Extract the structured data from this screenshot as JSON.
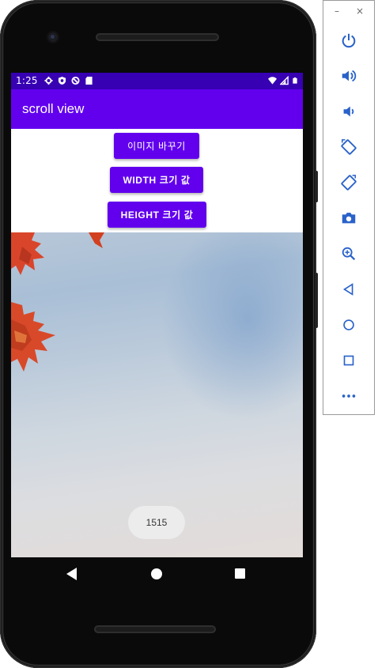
{
  "status_bar": {
    "time": "1:25",
    "icons_left": [
      "settings-icon",
      "shield-icon",
      "no-disturb-icon",
      "sd-card-icon"
    ],
    "icons_right": [
      "wifi-icon",
      "signal-icon",
      "battery-icon"
    ],
    "color": "#3700b3"
  },
  "app_bar": {
    "title": "scroll view",
    "color": "#6200ee"
  },
  "buttons": {
    "change_image": "이미지 바꾸기",
    "width_value": "WIDTH 크기 값",
    "height_value": "HEIGHT 크기 값"
  },
  "toast": {
    "text": "1515"
  },
  "nav_bar": {
    "icons": [
      "back-icon",
      "home-icon",
      "recents-icon"
    ]
  },
  "emulator_panel": {
    "window_controls": [
      "–",
      "×"
    ],
    "buttons": [
      "power-icon",
      "volume-up-icon",
      "volume-down-icon",
      "rotate-left-icon",
      "rotate-right-icon",
      "camera-icon",
      "zoom-icon",
      "back-icon",
      "home-icon",
      "overview-icon",
      "more-icon"
    ]
  }
}
